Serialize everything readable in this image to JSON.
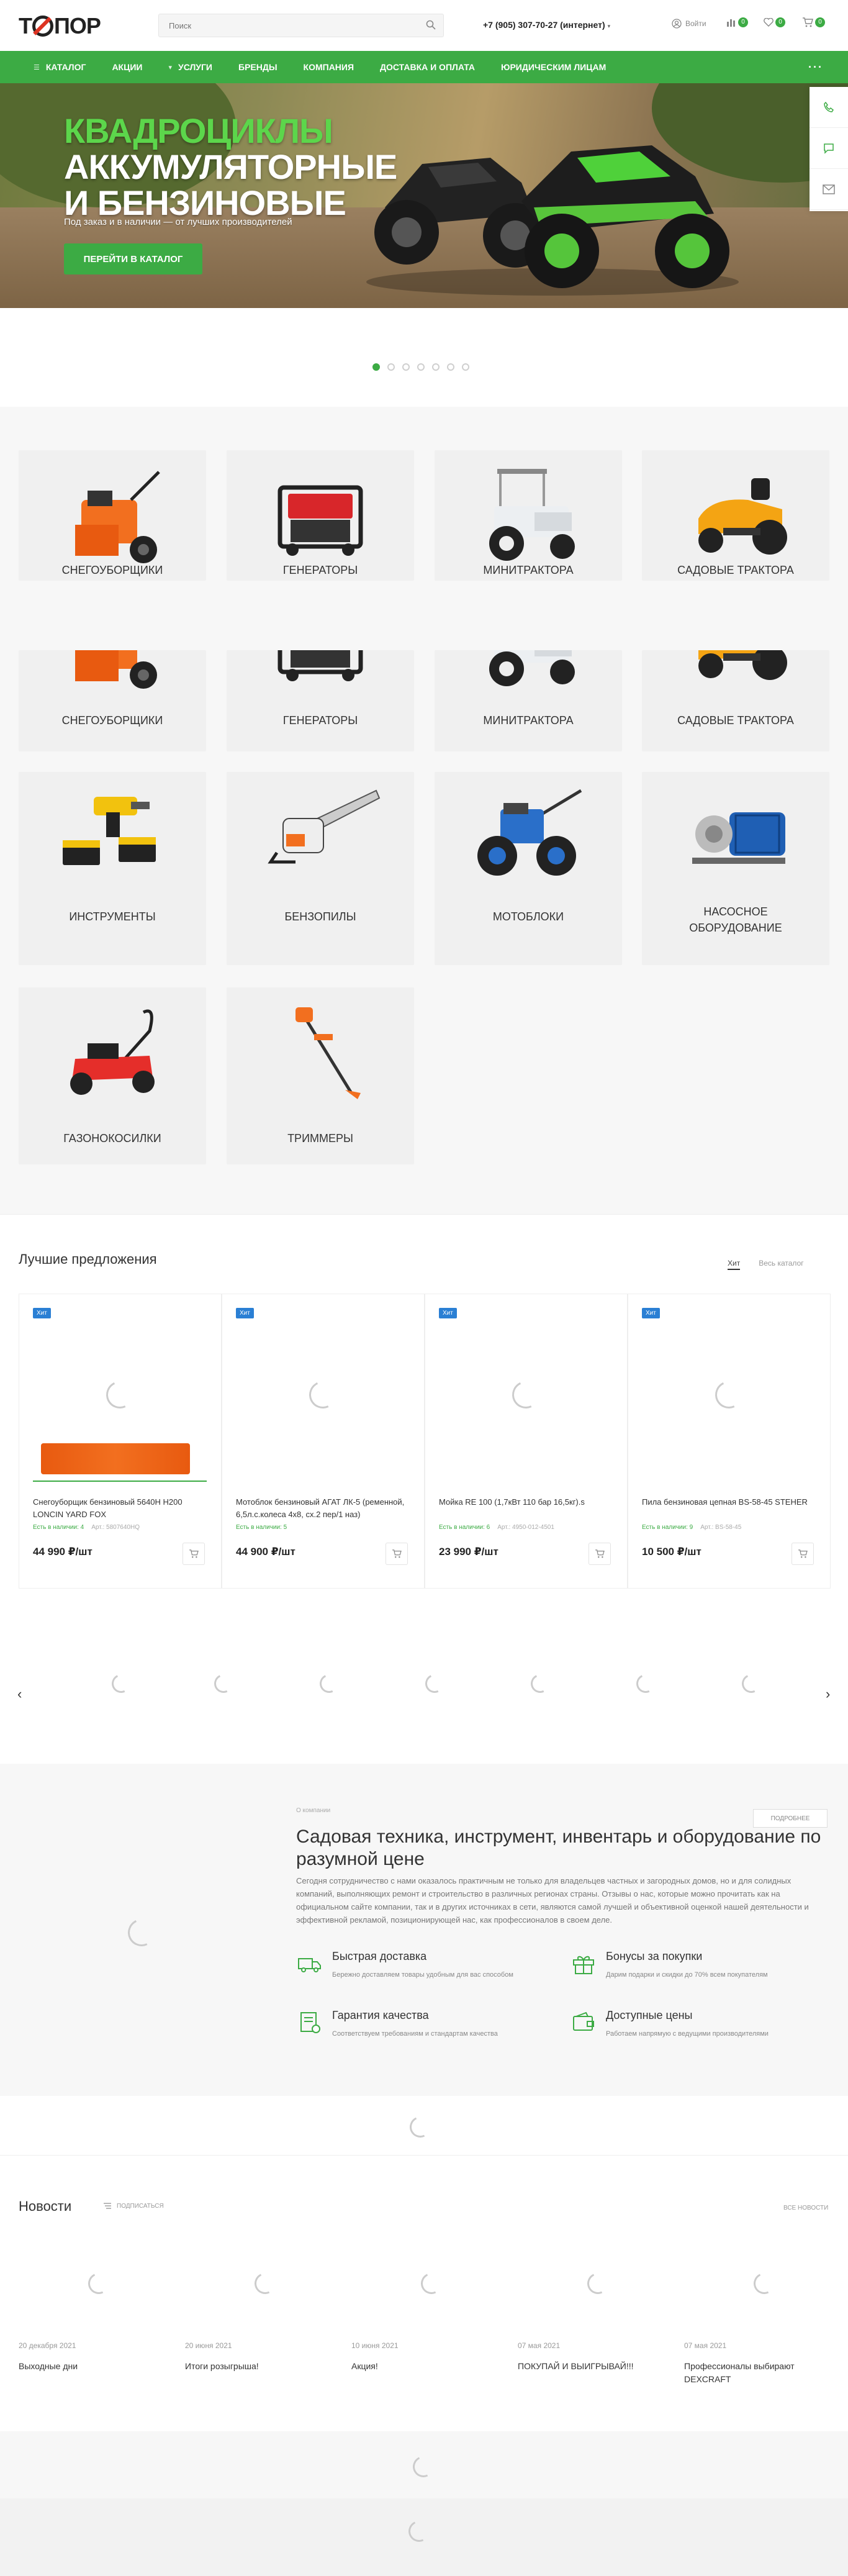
{
  "header": {
    "search_placeholder": "Поиск",
    "phone": "+7 (905) 307-70-27 (интернет)",
    "login": "Войти",
    "compare_count": "0",
    "favorites_count": "0",
    "cart_count": "0"
  },
  "nav": {
    "items": [
      {
        "label": "Каталог"
      },
      {
        "label": "Акции"
      },
      {
        "label": "Услуги"
      },
      {
        "label": "Бренды"
      },
      {
        "label": "Компания"
      },
      {
        "label": "Доставка и оплата"
      },
      {
        "label": "Юридическим лицам"
      }
    ],
    "more": "···"
  },
  "hero": {
    "title_line1": "Квадроциклы",
    "title_line2": "аккумуляторные",
    "title_line3": "и бензиновые",
    "subtitle": "Под заказ и в наличии — от лучших производителей",
    "button": "Перейти в каталог"
  },
  "slider": {
    "total": 7,
    "active": 0
  },
  "categories": [
    {
      "label": "Снегоуборщики"
    },
    {
      "label": "Генераторы"
    },
    {
      "label": "Минитрактора"
    },
    {
      "label": "Садовые трактора"
    },
    {
      "label": "Снегоуборщики"
    },
    {
      "label": "Генераторы"
    },
    {
      "label": "Минитрактора"
    },
    {
      "label": "Садовые трактора"
    },
    {
      "label": "Инструменты"
    },
    {
      "label": "Бензопилы"
    },
    {
      "label": "Мотоблоки"
    },
    {
      "label": "Насосное оборудование"
    },
    {
      "label": "Газонокосилки"
    },
    {
      "label": "Триммеры"
    }
  ],
  "offers": {
    "title": "Лучшие предложения",
    "tab_hit": "Хит",
    "all_link": "Весь каталог",
    "items": [
      {
        "badge": "Хит",
        "name": "Снегоуборщик бензиновый 5640H H200 LONCIN YARD FOX",
        "stock": "Есть в наличии: 4",
        "article": "Арт.: 5807640HQ",
        "price": "44 990 ₽/шт"
      },
      {
        "badge": "Хит",
        "name": "Мотоблок бензиновый АГАТ ЛК-5 (ременной, 6,5л.с.колеса 4х8, сх.2 пер/1 наз)",
        "stock": "Есть в наличии: 5",
        "article": "",
        "price": "44 900 ₽/шт"
      },
      {
        "badge": "Хит",
        "name": "Мойка RE 100 (1,7кВт 110 бар 16,5кг).s",
        "stock": "Есть в наличии: 6",
        "article": "Арт.: 4950-012-4501",
        "price": "23 990 ₽/шт"
      },
      {
        "badge": "Хит",
        "name": "Пила бензиновая цепная BS-58-45 STEHER",
        "stock": "Есть в наличии: 9",
        "article": "Арт.: BS-58-45",
        "price": "10 500 ₽/шт"
      }
    ]
  },
  "brands": {
    "prev": "‹",
    "next": "›"
  },
  "about": {
    "small": "О компании",
    "title": "Садовая техника, инструмент, инвентарь и оборудование по разумной цене",
    "text": "Сегодня сотрудничество с нами оказалось практичным не только для владельцев частных и загородных домов, но и для солидных компаний, выполняющих ремонт и строительство в различных регионах страны. Отзывы о нас, которые можно прочитать как на официальном сайте компании, так и в других источниках в сети, являются самой лучшей и объективной оценкой нашей деятельности и эффективной рекламой, позиционирующей нас, как профессионалов в своем деле.",
    "button": "Подробнее",
    "features": [
      {
        "title": "Быстрая доставка",
        "desc": "Бережно доставляем товары удобным для вас способом"
      },
      {
        "title": "Бонусы за покупки",
        "desc": "Дарим подарки и скидки до 70% всем покупателям"
      },
      {
        "title": "Гарантия качества",
        "desc": "Соответствуем требованиям и стандартам качества"
      },
      {
        "title": "Доступные цены",
        "desc": "Работаем напрямую с ведущими производителями"
      }
    ]
  },
  "news": {
    "title": "Новости",
    "subscribe": "Подписаться",
    "all": "Все новости",
    "items": [
      {
        "date": "20 декабря 2021",
        "title": "Выходные дни"
      },
      {
        "date": "20 июня 2021",
        "title": "Итоги розыгрыша!"
      },
      {
        "date": "10 июня 2021",
        "title": "Акция!"
      },
      {
        "date": "07 мая 2021",
        "title": "ПОКУПАЙ И ВЫИГРЫВАЙ!!!"
      },
      {
        "date": "07 мая 2021",
        "title": "Профессионалы выбирают DEXCRAFT"
      }
    ]
  },
  "colors": {
    "accent": "#3cab44",
    "badge": "#2a7fd4",
    "dark": "#222222"
  }
}
